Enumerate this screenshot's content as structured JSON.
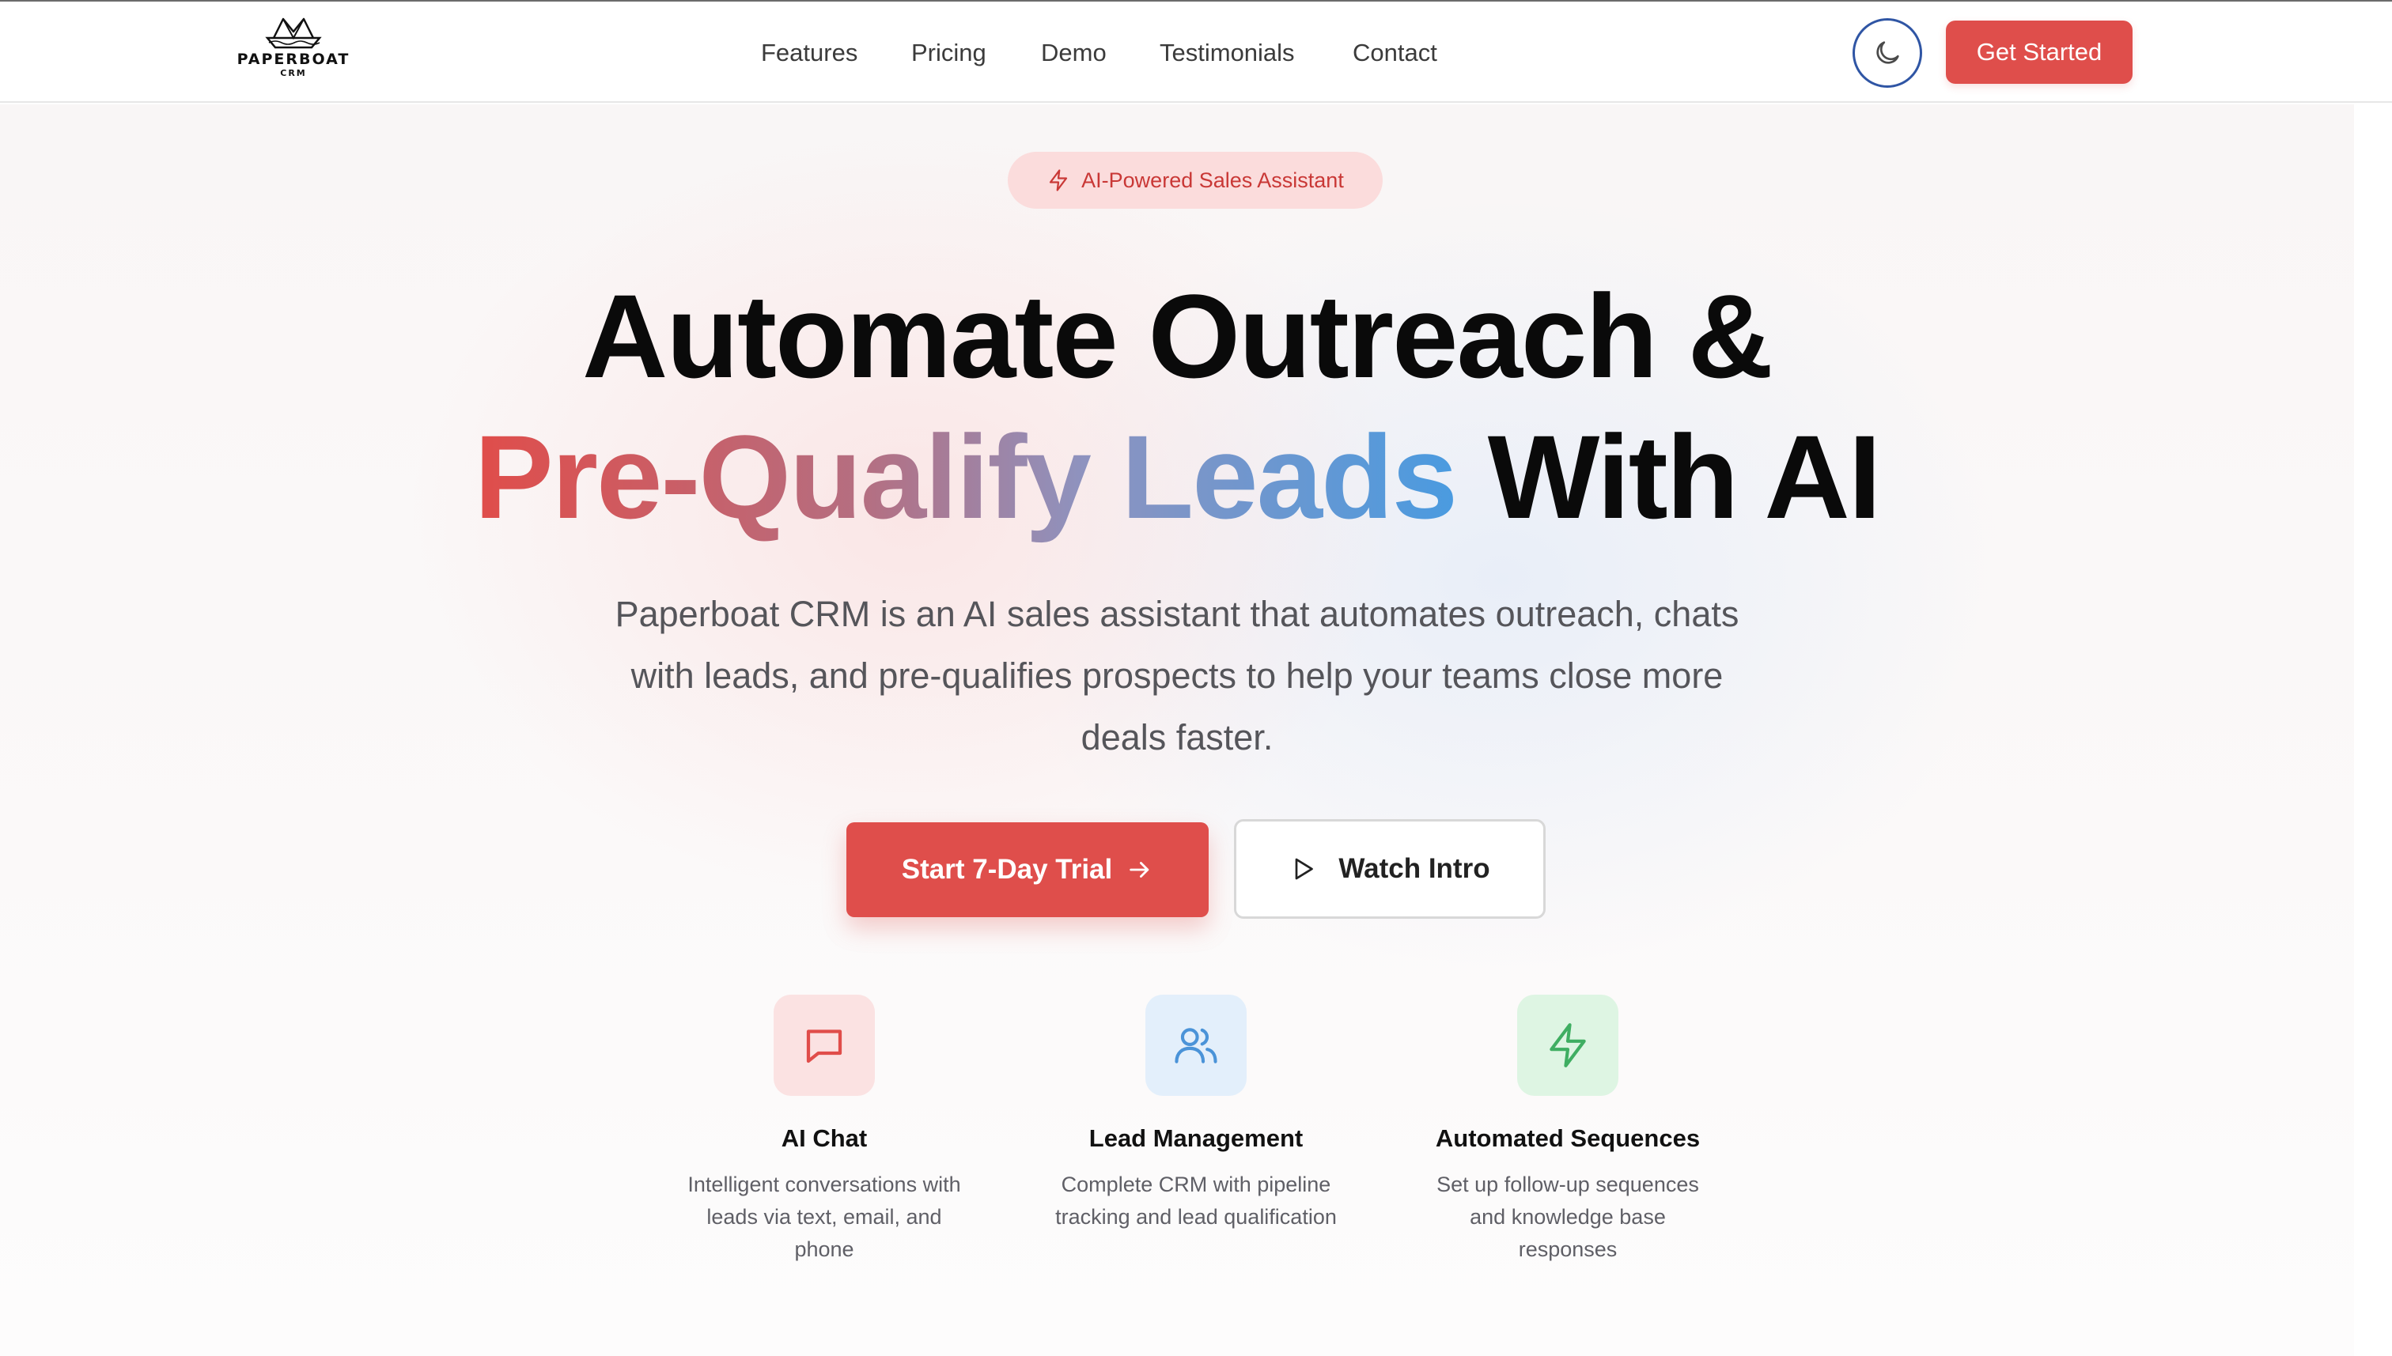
{
  "header": {
    "logo": {
      "word": "PAPERBOAT",
      "sub": "CRM"
    },
    "nav": [
      "Features",
      "Pricing",
      "Demo",
      "Testimonials",
      "Contact"
    ],
    "theme_toggle_icon": "moon-icon",
    "cta": "Get Started"
  },
  "hero": {
    "badge": "AI-Powered Sales Assistant",
    "badge_icon": "lightning-icon",
    "headline_line1": "Automate Outreach &",
    "headline_gradient": "Pre-Qualify Leads",
    "headline_rest": "With AI",
    "description": "Paperboat CRM is an AI sales assistant that automates outreach, chats with leads, and pre-qualifies prospects to help your teams close more deals faster.",
    "primary_cta": "Start 7-Day Trial",
    "secondary_cta": "Watch Intro"
  },
  "features": [
    {
      "title": "AI Chat",
      "text": "Intelligent conversations with leads via text, email, and phone",
      "icon": "chat-bubble-icon",
      "color": "#e04d4a",
      "bg": "#fbe2e2"
    },
    {
      "title": "Lead Management",
      "text": "Complete CRM with pipeline tracking and lead qualification",
      "icon": "users-icon",
      "color": "#4a93d8",
      "bg": "#e3effb"
    },
    {
      "title": "Automated Sequences",
      "text": "Set up follow-up sequences and knowledge base responses",
      "icon": "lightning-icon",
      "color": "#3fae62",
      "bg": "#def5e3"
    }
  ],
  "colors": {
    "accent": "#df4e4b",
    "badge_bg": "#fbdcdc",
    "toggle_border": "#2f55a4"
  }
}
